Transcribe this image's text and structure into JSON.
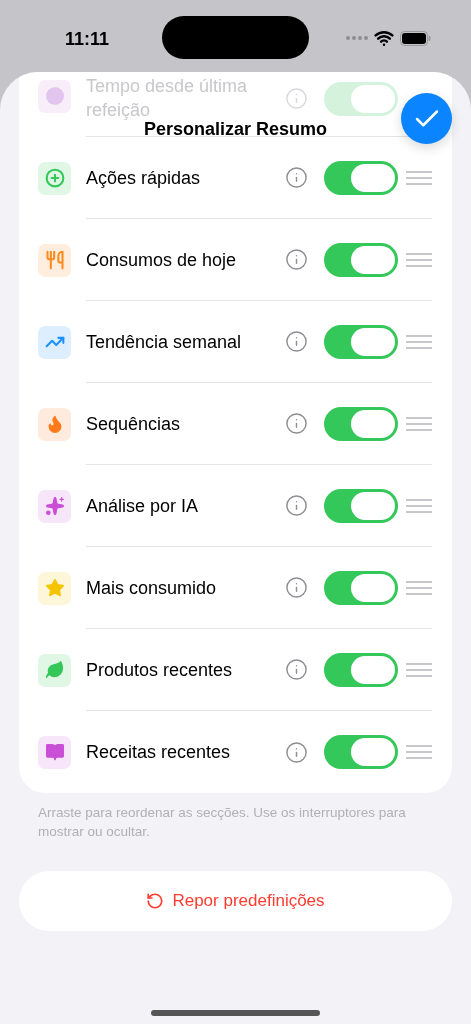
{
  "status_bar": {
    "time": "11:11"
  },
  "sheet": {
    "title": "Personalizar Resumo"
  },
  "sections": [
    {
      "kind": "faded",
      "label": "Tempo desde última refeição",
      "color": "#e3c4ee",
      "on": true
    },
    {
      "kind": "normal",
      "label": "Ações rápidas",
      "color": "#34c759",
      "on": true
    },
    {
      "kind": "normal",
      "label": "Consumos de hoje",
      "color": "#ff8a1f",
      "on": true
    },
    {
      "kind": "normal",
      "label": "Tendência semanal",
      "color": "#1e90ff",
      "on": true
    },
    {
      "kind": "normal",
      "label": "Sequências",
      "color": "#ff7a1a",
      "on": true
    },
    {
      "kind": "normal",
      "label": "Análise por IA",
      "color": "#c94fd6",
      "on": true
    },
    {
      "kind": "normal",
      "label": "Mais consumido",
      "color": "#f5c400",
      "on": true
    },
    {
      "kind": "normal",
      "label": "Produtos recentes",
      "color": "#34c759",
      "on": true
    },
    {
      "kind": "normal",
      "label": "Receitas recentes",
      "color": "#c94fd6",
      "on": true
    }
  ],
  "hint": "Arraste para reordenar as secções. Use os interruptores para mostrar ou ocultar.",
  "reset_button": "Repor predefinições"
}
